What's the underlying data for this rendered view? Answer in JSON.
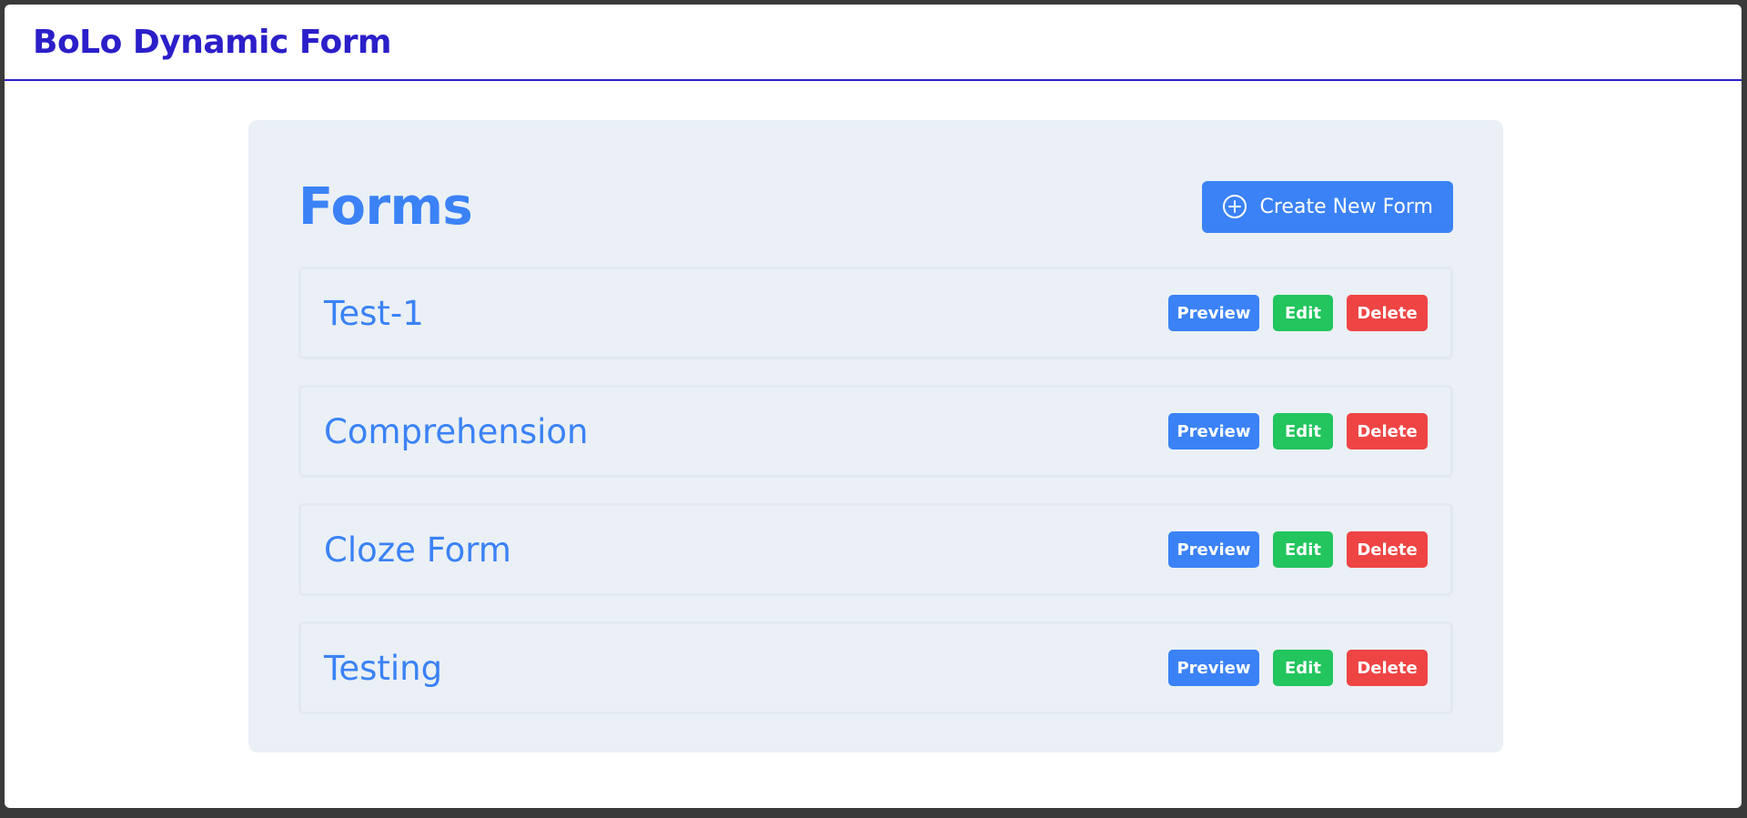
{
  "app": {
    "title": "BoLo Dynamic Form"
  },
  "main": {
    "title": "Forms",
    "create_button": {
      "label": "Create New Form",
      "icon": "plus-circle-icon"
    },
    "forms": [
      {
        "name": "Test-1",
        "preview": "Preview",
        "edit": "Edit",
        "delete": "Delete"
      },
      {
        "name": "Comprehension",
        "preview": "Preview",
        "edit": "Edit",
        "delete": "Delete"
      },
      {
        "name": "Cloze Form",
        "preview": "Preview",
        "edit": "Edit",
        "delete": "Delete"
      },
      {
        "name": "Testing",
        "preview": "Preview",
        "edit": "Edit",
        "delete": "Delete"
      }
    ]
  },
  "colors": {
    "brand": "#2b1fc9",
    "accent": "#3b82f6",
    "success": "#22c55e",
    "danger": "#ef4444",
    "panel_bg": "#eaf0f5"
  }
}
